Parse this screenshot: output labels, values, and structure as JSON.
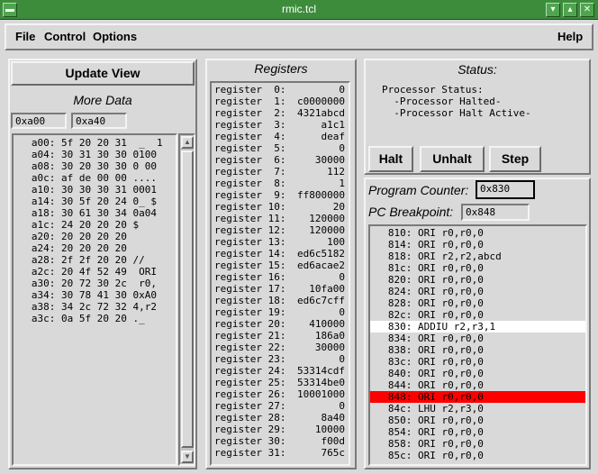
{
  "window": {
    "title": "rmic.tcl"
  },
  "menu": {
    "file": "File",
    "control": "Control",
    "options": "Options",
    "help": "Help"
  },
  "left": {
    "update_label": "Update View",
    "more_data_heading": "More Data",
    "addr_start": "0xa00",
    "addr_end": "0xa40",
    "memory": [
      "   a00: 5f 20 20 31  _  1",
      "   a04: 30 31 30 30 0100",
      "   a08: 30 20 30 30 0 00",
      "   a0c: af de 00 00 ....",
      "   a10: 30 30 30 31 0001",
      "   a14: 30 5f 20 24 0_ $",
      "   a18: 30 61 30 34 0a04",
      "   a1c: 24 20 20 20 $",
      "   a20: 20 20 20 20",
      "   a24: 20 20 20 20",
      "   a28: 2f 2f 20 20 //",
      "   a2c: 20 4f 52 49  ORI",
      "   a30: 20 72 30 2c  r0,",
      "   a34: 30 78 41 30 0xA0",
      "   a38: 34 2c 72 32 4,r2",
      "   a3c: 0a 5f 20 20 ._"
    ]
  },
  "registers": {
    "heading": "Registers",
    "rows": [
      {
        "name": "register  0:",
        "value": "0"
      },
      {
        "name": "register  1:",
        "value": "c0000000"
      },
      {
        "name": "register  2:",
        "value": "4321abcd"
      },
      {
        "name": "register  3:",
        "value": "a1c1"
      },
      {
        "name": "register  4:",
        "value": "deaf"
      },
      {
        "name": "register  5:",
        "value": "0"
      },
      {
        "name": "register  6:",
        "value": "30000"
      },
      {
        "name": "register  7:",
        "value": "112"
      },
      {
        "name": "register  8:",
        "value": "1"
      },
      {
        "name": "register  9:",
        "value": "ff800000"
      },
      {
        "name": "register 10:",
        "value": "20"
      },
      {
        "name": "register 11:",
        "value": "120000"
      },
      {
        "name": "register 12:",
        "value": "120000"
      },
      {
        "name": "register 13:",
        "value": "100"
      },
      {
        "name": "register 14:",
        "value": "ed6c5182"
      },
      {
        "name": "register 15:",
        "value": "ed6acae2"
      },
      {
        "name": "register 16:",
        "value": "0"
      },
      {
        "name": "register 17:",
        "value": "10fa00"
      },
      {
        "name": "register 18:",
        "value": "ed6c7cff"
      },
      {
        "name": "register 19:",
        "value": "0"
      },
      {
        "name": "register 20:",
        "value": "410000"
      },
      {
        "name": "register 21:",
        "value": "186a0"
      },
      {
        "name": "register 22:",
        "value": "30000"
      },
      {
        "name": "register 23:",
        "value": "0"
      },
      {
        "name": "register 24:",
        "value": "53314cdf"
      },
      {
        "name": "register 25:",
        "value": "53314be0"
      },
      {
        "name": "register 26:",
        "value": "10001000"
      },
      {
        "name": "register 27:",
        "value": "0"
      },
      {
        "name": "register 28:",
        "value": "8a40"
      },
      {
        "name": "register 29:",
        "value": "10000"
      },
      {
        "name": "register 30:",
        "value": "f00d"
      },
      {
        "name": "register 31:",
        "value": "765c"
      }
    ]
  },
  "status": {
    "heading": "Status:",
    "lines": [
      "Processor Status:",
      "  -Processor Halted-",
      "  -Processor Halt Active-"
    ]
  },
  "controls": {
    "halt_label": "Halt",
    "unhalt_label": "Unhalt",
    "step_label": "Step",
    "pc_label": "Program Counter:",
    "pc_value": "0x830",
    "bp_label": "PC Breakpoint:",
    "bp_value": "0x848"
  },
  "program": [
    {
      "text": "   810: ORI r0,r0,0",
      "state": "normal"
    },
    {
      "text": "   814: ORI r0,r0,0",
      "state": "normal"
    },
    {
      "text": "   818: ORI r2,r2,abcd",
      "state": "normal"
    },
    {
      "text": "   81c: ORI r0,r0,0",
      "state": "normal"
    },
    {
      "text": "   820: ORI r0,r0,0",
      "state": "normal"
    },
    {
      "text": "   824: ORI r0,r0,0",
      "state": "normal"
    },
    {
      "text": "   828: ORI r0,r0,0",
      "state": "normal"
    },
    {
      "text": "   82c: ORI r0,r0,0",
      "state": "normal"
    },
    {
      "text": "   830: ADDIU r2,r3,1",
      "state": "current"
    },
    {
      "text": "   834: ORI r0,r0,0",
      "state": "normal"
    },
    {
      "text": "   838: ORI r0,r0,0",
      "state": "normal"
    },
    {
      "text": "   83c: ORI r0,r0,0",
      "state": "normal"
    },
    {
      "text": "   840: ORI r0,r0,0",
      "state": "normal"
    },
    {
      "text": "   844: ORI r0,r0,0",
      "state": "normal"
    },
    {
      "text": "   848: ORI r0,r0,0",
      "state": "breakpoint"
    },
    {
      "text": "   84c: LHU r2,r3,0",
      "state": "normal"
    },
    {
      "text": "   850: ORI r0,r0,0",
      "state": "normal"
    },
    {
      "text": "   854: ORI r0,r0,0",
      "state": "normal"
    },
    {
      "text": "   858: ORI r0,r0,0",
      "state": "normal"
    },
    {
      "text": "   85c: ORI r0,r0,0",
      "state": "normal"
    }
  ],
  "colors": {
    "titlebar": "#3c8c3c",
    "current_line": "#ffffff",
    "breakpoint_line": "#ff0000"
  }
}
